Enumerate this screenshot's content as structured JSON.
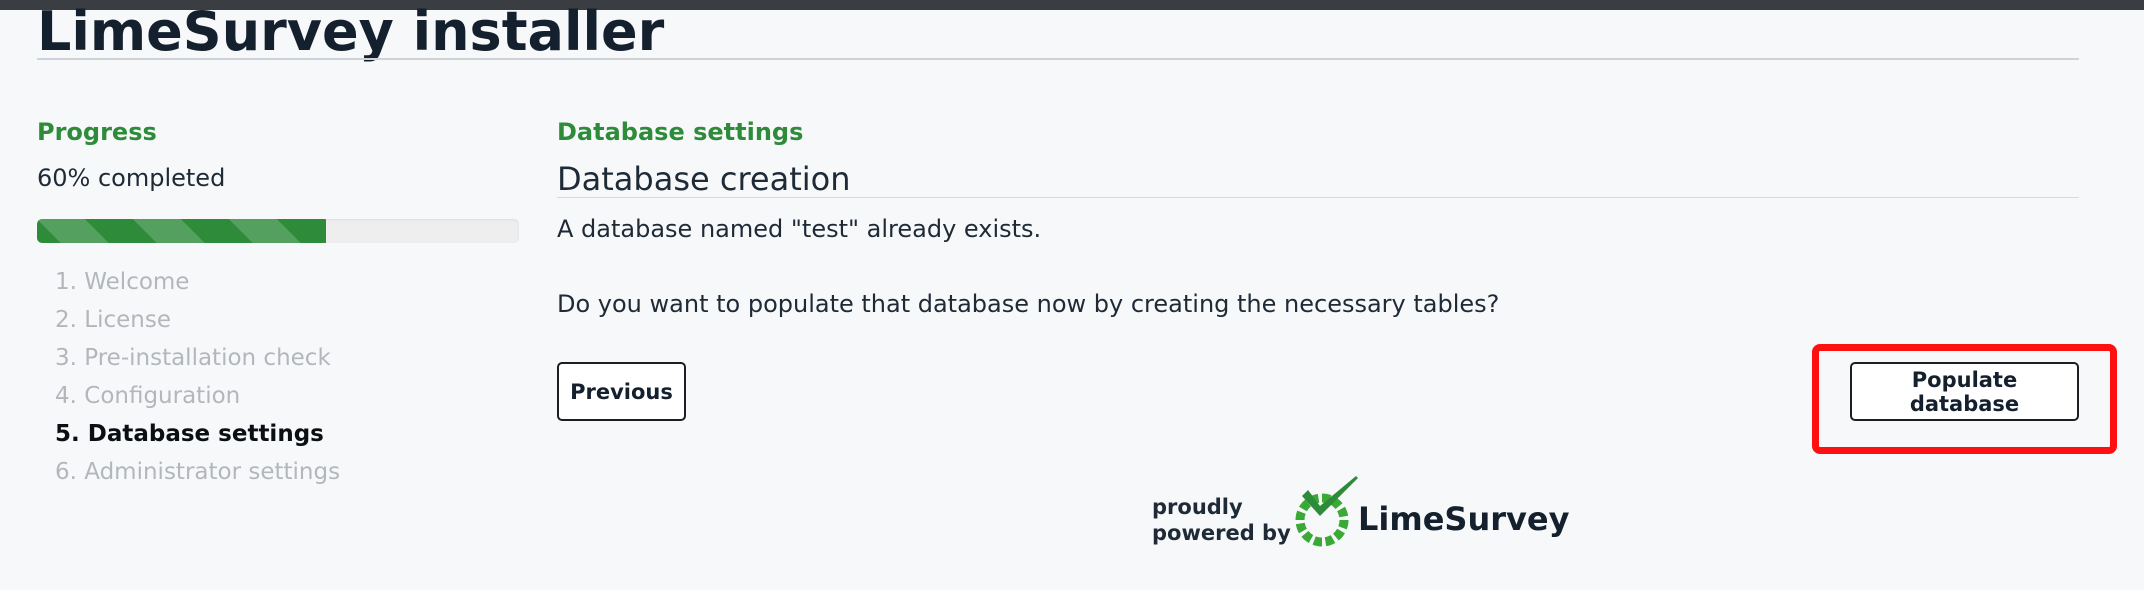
{
  "page": {
    "title": "LimeSurvey installer"
  },
  "sidebar": {
    "heading": "Progress",
    "progress_text": "60% completed",
    "progress_value": 0.6,
    "steps": [
      {
        "label": "1. Welcome",
        "active": false
      },
      {
        "label": "2. License",
        "active": false
      },
      {
        "label": "3. Pre-installation check",
        "active": false
      },
      {
        "label": "4. Configuration",
        "active": false
      },
      {
        "label": "5. Database settings",
        "active": true
      },
      {
        "label": "6. Administrator settings",
        "active": false
      }
    ]
  },
  "main": {
    "heading": "Database settings",
    "section_title": "Database creation",
    "message_exists": "A database named \"test\" already exists.",
    "message_question": "Do you want to populate that database now by creating the necessary tables?",
    "previous_label": "Previous",
    "populate_label": "Populate database"
  },
  "footer": {
    "powered_line1": "proudly",
    "powered_line2": "powered by",
    "brand": "LimeSurvey"
  },
  "colors": {
    "accent_green": "#2e8b3a",
    "highlight_red": "#ff1010",
    "top_bar": "#3a3d42"
  },
  "icons": {
    "logo": "limesurvey-logo-icon"
  }
}
